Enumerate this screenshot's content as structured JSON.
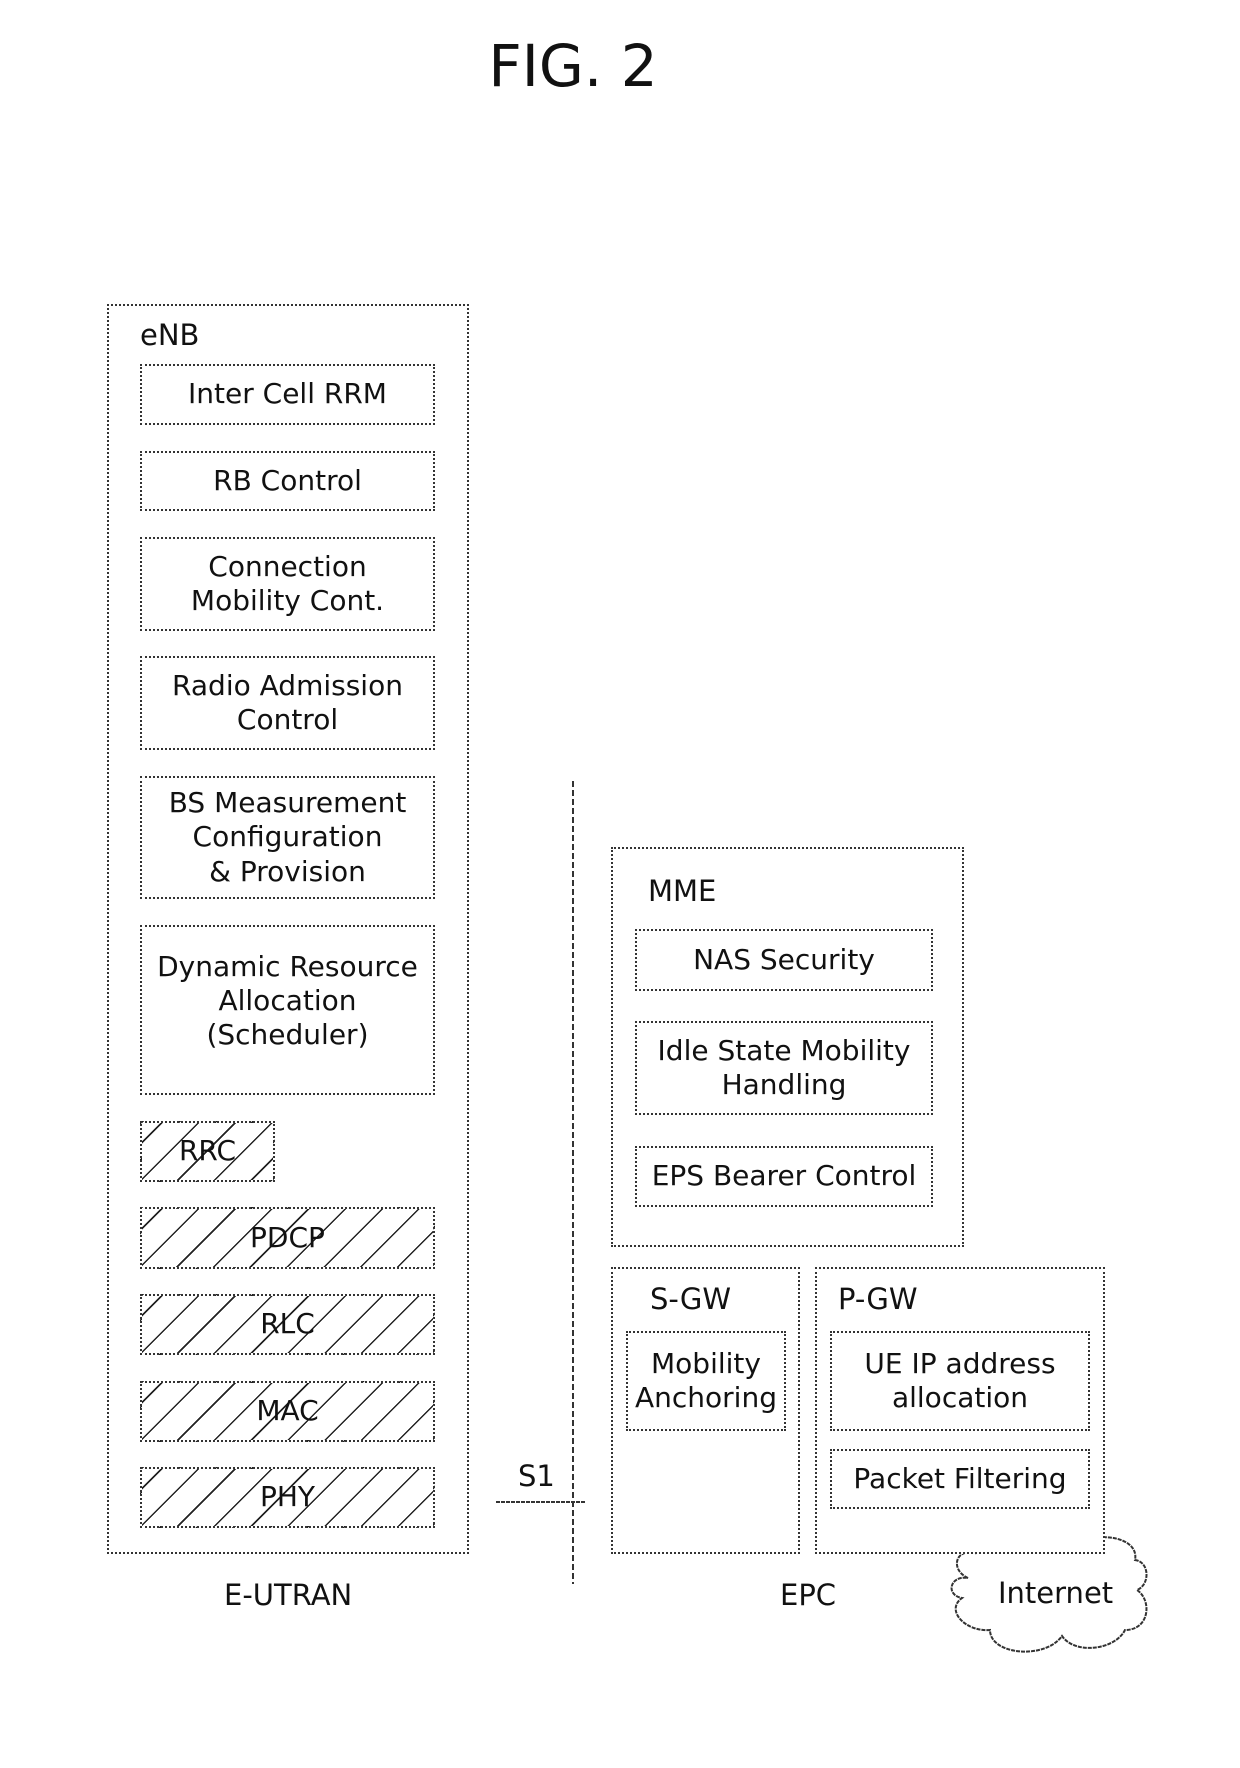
{
  "figure": {
    "title": "FIG. 2"
  },
  "enb": {
    "label": "eNB",
    "functions": [
      "Inter Cell RRM",
      "RB Control",
      "Connection\nMobility Cont.",
      "Radio Admission\nControl",
      "BS Measurement\nConfiguration\n& Provision",
      "Dynamic Resource\nAllocation\n(Scheduler)"
    ],
    "protocol_layers": [
      "RRC",
      "PDCP",
      "RLC",
      "MAC",
      "PHY"
    ]
  },
  "interface": {
    "label": "S1"
  },
  "mme": {
    "label": "MME",
    "functions": [
      "NAS Security",
      "Idle State Mobility\nHandling",
      "EPS Bearer Control"
    ]
  },
  "sgw": {
    "label": "S-GW",
    "functions": [
      "Mobility\nAnchoring"
    ]
  },
  "pgw": {
    "label": "P-GW",
    "functions": [
      "UE IP address\nallocation",
      "Packet Filtering"
    ]
  },
  "regions": {
    "left": "E-UTRAN",
    "right": "EPC"
  },
  "internet": {
    "label": "Internet"
  }
}
